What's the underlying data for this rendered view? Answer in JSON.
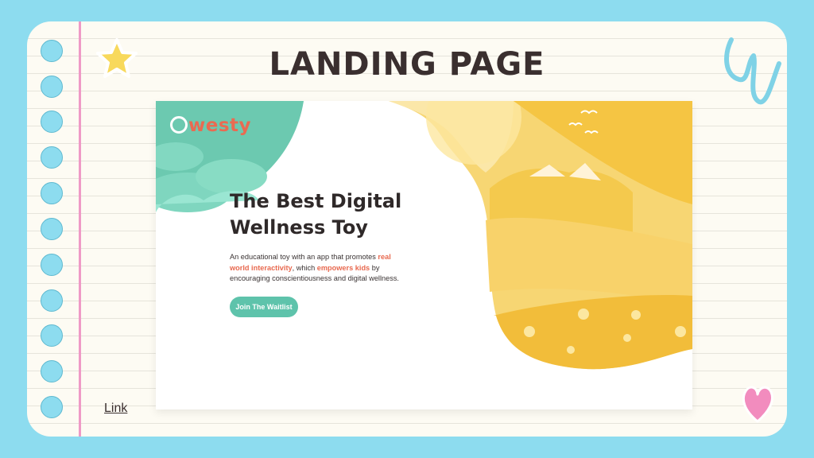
{
  "slide": {
    "title": "LANDING PAGE",
    "link_label": "Link"
  },
  "landing": {
    "logo_letter": "Q",
    "logo_text": "westy",
    "hero_title_line1": "The Best Digital",
    "hero_title_line2": "Wellness Toy",
    "desc_part1": "An educational toy with an app that promotes ",
    "desc_highlight1": "real world interactivity",
    "desc_part2": ", which ",
    "desc_highlight2": "empowers kids",
    "desc_part3": " by encouraging conscientiousness and digital wellness.",
    "cta_label": "Join The Waitlist"
  },
  "colors": {
    "page_background": "#8ddcef",
    "notebook_paper": "#fdfbf3",
    "margin_line": "#ef9ac6",
    "accent_teal": "#5ec3ab",
    "accent_orange": "#e8694f",
    "sun_yellow": "#f4c74e",
    "title_text": "#3a2f2f"
  },
  "icons": [
    "star-icon",
    "squiggle-icon",
    "heart-icon"
  ]
}
